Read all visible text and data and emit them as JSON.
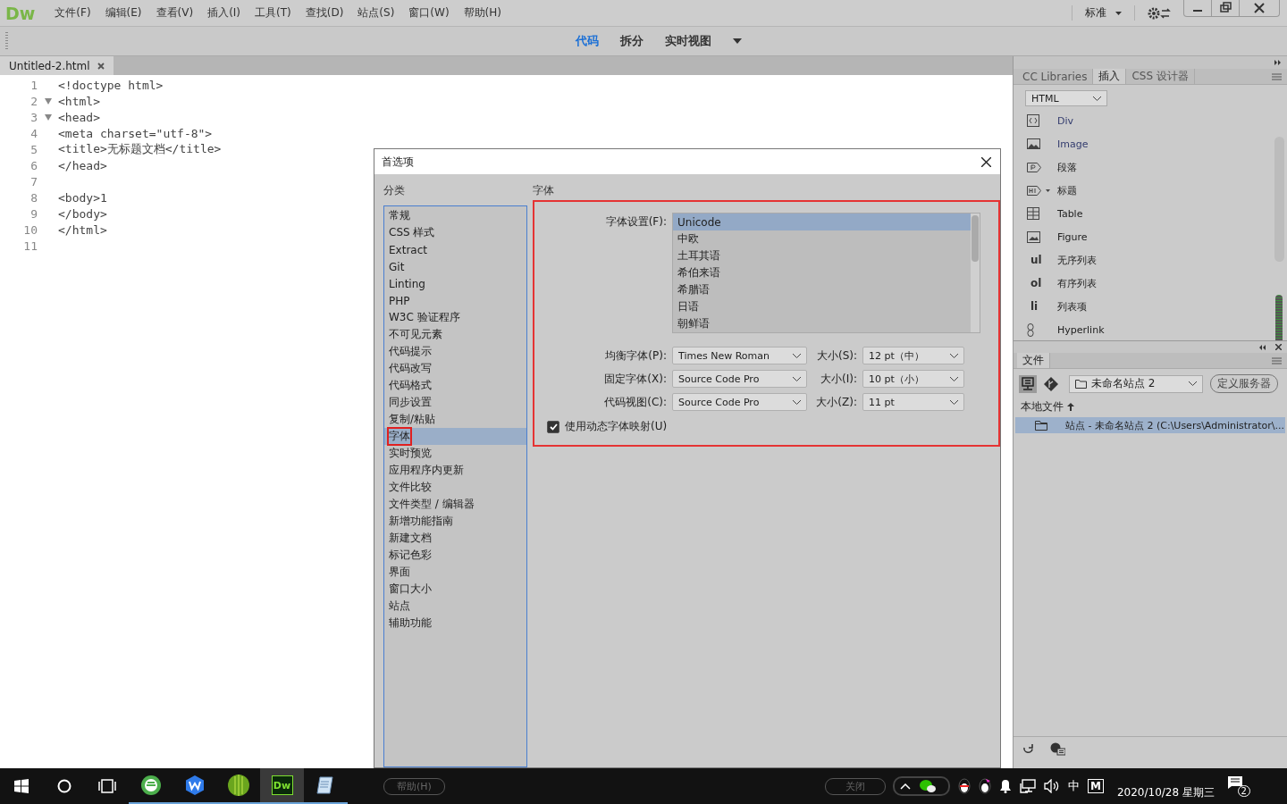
{
  "app": {
    "logo": "Dw",
    "menu": [
      "文件(F)",
      "编辑(E)",
      "查看(V)",
      "插入(I)",
      "工具(T)",
      "查找(D)",
      "站点(S)",
      "窗口(W)",
      "帮助(H)"
    ],
    "workspace": "标准"
  },
  "view_modes": [
    {
      "label": "代码",
      "selected": true
    },
    {
      "label": "拆分",
      "selected": false
    },
    {
      "label": "实时视图",
      "selected": false
    }
  ],
  "document_tab": {
    "title": "Untitled-2.html"
  },
  "code": [
    {
      "line": "1",
      "text": "<!doctype html>",
      "foldable": false
    },
    {
      "line": "2",
      "text": "<html>",
      "foldable": true
    },
    {
      "line": "3",
      "text": "<head>",
      "foldable": true
    },
    {
      "line": "4",
      "text": "<meta charset=\"utf-8\">",
      "foldable": false
    },
    {
      "line": "5",
      "text": "<title>无标题文档</title>",
      "foldable": false
    },
    {
      "line": "6",
      "text": "</head>",
      "foldable": false
    },
    {
      "line": "7",
      "foldable": false
    },
    {
      "line": "8",
      "text": "<body>1",
      "foldable": false
    },
    {
      "line": "9",
      "text": "</body>",
      "foldable": false
    },
    {
      "line": "10",
      "text": "</html>",
      "foldable": false
    },
    {
      "line": "11",
      "foldable": false
    }
  ],
  "dialog": {
    "title": "首选项",
    "category_heading": "分类",
    "section_heading": "字体",
    "categories": [
      {
        "label": "常规",
        "selected": false
      },
      {
        "label": "CSS 样式",
        "selected": false
      },
      {
        "label": "Extract",
        "selected": false
      },
      {
        "label": "Git",
        "selected": false
      },
      {
        "label": "Linting",
        "selected": false
      },
      {
        "label": "PHP",
        "selected": false
      },
      {
        "label": "W3C 验证程序",
        "selected": false
      },
      {
        "label": "不可见元素",
        "selected": false
      },
      {
        "label": "代码提示",
        "selected": false
      },
      {
        "label": "代码改写",
        "selected": false
      },
      {
        "label": "代码格式",
        "selected": false
      },
      {
        "label": "同步设置",
        "selected": false
      },
      {
        "label": "复制/粘贴",
        "selected": false
      },
      {
        "label": "字体",
        "selected": true
      },
      {
        "label": "实时预览",
        "selected": false
      },
      {
        "label": "应用程序内更新",
        "selected": false
      },
      {
        "label": "文件比较",
        "selected": false
      },
      {
        "label": "文件类型 / 编辑器",
        "selected": false
      },
      {
        "label": "新增功能指南",
        "selected": false
      },
      {
        "label": "新建文档",
        "selected": false
      },
      {
        "label": "标记色彩",
        "selected": false
      },
      {
        "label": "界面",
        "selected": false
      },
      {
        "label": "窗口大小",
        "selected": false
      },
      {
        "label": "站点",
        "selected": false
      },
      {
        "label": "辅助功能",
        "selected": false
      }
    ],
    "font_settings_label": "字体设置(F):",
    "encodings": [
      {
        "label": "Unicode",
        "selected": true
      },
      {
        "label": "中欧",
        "selected": false
      },
      {
        "label": "土耳其语",
        "selected": false
      },
      {
        "label": "希伯来语",
        "selected": false
      },
      {
        "label": "希腊语",
        "selected": false
      },
      {
        "label": "日语",
        "selected": false
      },
      {
        "label": "朝鲜语",
        "selected": false
      }
    ],
    "fonts": [
      {
        "label": "均衡字体(P):",
        "font": "Times New Roman",
        "size_label": "大小(S):",
        "size": "12 pt（中）"
      },
      {
        "label": "固定字体(X):",
        "font": "Source Code Pro",
        "size_label": "大小(I):",
        "size": "10 pt（小）"
      },
      {
        "label": "代码视图(C):",
        "font": "Source Code Pro",
        "size_label": "大小(Z):",
        "size": "11 pt"
      }
    ],
    "dynamic_mapping": {
      "label": "使用动态字体映射(U)",
      "checked": true
    },
    "buttons": [
      "帮助(H)",
      "关闭"
    ]
  },
  "insert_panel": {
    "tabs": [
      {
        "label": "CC Libraries",
        "selected": false
      },
      {
        "label": "插入",
        "selected": true
      },
      {
        "label": "CSS 设计器",
        "selected": false
      }
    ],
    "category": "HTML",
    "items": [
      {
        "kind": "div",
        "label": "Div"
      },
      {
        "kind": "image",
        "label": "Image"
      },
      {
        "kind": "paragraph",
        "label": "段落"
      },
      {
        "kind": "heading",
        "label": "标题"
      },
      {
        "kind": "table",
        "label": "Table"
      },
      {
        "kind": "figure",
        "label": "Figure"
      },
      {
        "kind": "glyph",
        "glyph": "ul",
        "label": "无序列表"
      },
      {
        "kind": "glyph",
        "glyph": "ol",
        "label": "有序列表"
      },
      {
        "kind": "glyph",
        "glyph": "li",
        "label": "列表项"
      },
      {
        "kind": "link",
        "label": "Hyperlink"
      }
    ]
  },
  "files_panel": {
    "tab": "文件",
    "site": "未命名站点 2",
    "define_server": "定义服务器",
    "header": "本地文件",
    "rows": [
      {
        "label": "站点 - 未命名站点 2 (C:\\Users\\Administrator\\...",
        "selected": true
      }
    ]
  },
  "taskbar": {
    "apps": [
      {
        "kind": "browser",
        "selected": false
      },
      {
        "kind": "wps",
        "selected": false
      },
      {
        "kind": "ball",
        "selected": false
      },
      {
        "kind": "dw",
        "label": "Dw",
        "selected": true
      },
      {
        "kind": "notepad",
        "selected": false
      }
    ],
    "ime": "中",
    "tray_letter": "M",
    "date": "2020/10/28 星期三",
    "notification_count": "2"
  }
}
